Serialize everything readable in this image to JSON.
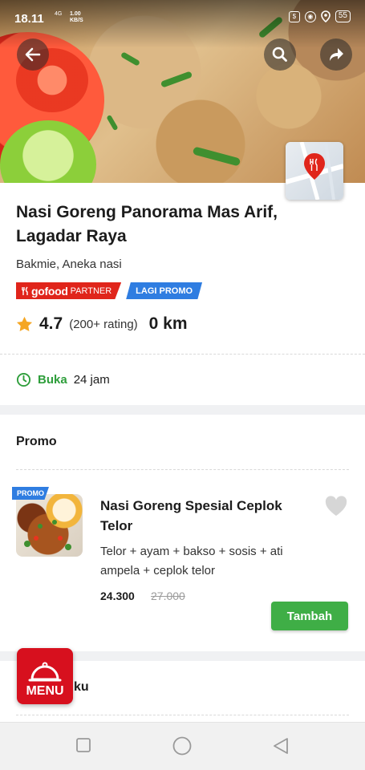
{
  "status_bar": {
    "time": "18.11",
    "network": "4G",
    "speed_value": "1.00",
    "speed_unit": "KB/S",
    "battery": "55"
  },
  "restaurant": {
    "name": "Nasi Goreng Panorama Mas Arif, Lagadar Raya",
    "cuisines": "Bakmie, Aneka nasi",
    "badge_partner_logo": "gofood",
    "badge_partner_text": "PARTNER",
    "badge_promo": "LAGI PROMO",
    "rating": "4.7",
    "rating_count": "(200+ rating)",
    "distance": "0 km",
    "status": "Buka",
    "hours": "24 jam"
  },
  "sections": {
    "promo_title": "Promo",
    "next_title_partial": "ku"
  },
  "promo_item": {
    "ribbon": "PROMO",
    "name": "Nasi Goreng Spesial Ceplok Telor",
    "description": "Telor + ayam + bakso + sosis + ati ampela + ceplok telor",
    "price": "24.300",
    "original_price": "27.000",
    "add_button": "Tambah"
  },
  "menu_button": {
    "label": "MENU"
  },
  "icons": {
    "back": "arrow-left-icon",
    "search": "search-icon",
    "share": "share-icon",
    "map": "map-pin-icon",
    "star": "star-icon",
    "clock": "clock-icon",
    "heart": "heart-icon",
    "cloche": "food-cloche-icon"
  },
  "colors": {
    "gojek_green": "#3fae46",
    "gofood_red": "#e0251b",
    "promo_blue": "#2f7de1",
    "star": "#f5a623",
    "menu_red": "#d7101e"
  }
}
